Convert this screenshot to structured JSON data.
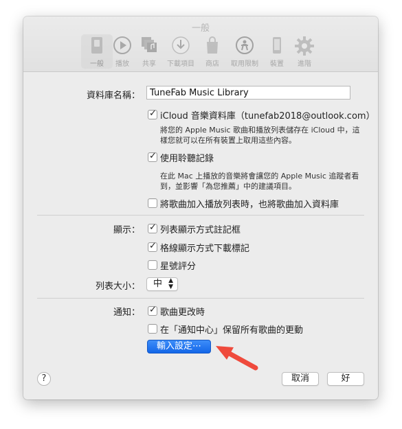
{
  "window": {
    "title": "一般"
  },
  "toolbar": {
    "items": [
      {
        "label": "一般",
        "icon": "general-switch-icon"
      },
      {
        "label": "播放",
        "icon": "play-icon"
      },
      {
        "label": "共享",
        "icon": "share-music-icon"
      },
      {
        "label": "下載項目",
        "icon": "download-icon"
      },
      {
        "label": "商店",
        "icon": "store-bag-icon"
      },
      {
        "label": "取用限制",
        "icon": "restrictions-icon"
      },
      {
        "label": "裝置",
        "icon": "device-icon"
      },
      {
        "label": "進階",
        "icon": "gear-icon"
      }
    ]
  },
  "library": {
    "name_label": "資料庫名稱：",
    "name_value": "TuneFab Music Library",
    "icloud_label": "iCloud 音樂資料庫（tunefab2018@outlook.com）",
    "icloud_checked": true,
    "icloud_desc_1": "將您的 Apple Music 歌曲和播放列表儲存在 iCloud 中，這",
    "icloud_desc_2": "樣您就可以在所有裝置上取用這些內容。",
    "history_label": "使用聆聽記錄",
    "history_checked": true,
    "history_desc_1": "在此 Mac 上播放的音樂將會讓您的 Apple Music 追蹤者看",
    "history_desc_2": "到，並影響「為您推薦」中的建議項目。",
    "add_songs_label": "將歌曲加入播放列表時，也將歌曲加入資料庫",
    "add_songs_checked": false
  },
  "display": {
    "label": "顯示：",
    "list_checkbox": "列表顯示方式註記框",
    "list_checked": true,
    "grid_download": "格線顯示方式下載標記",
    "grid_checked": true,
    "star_rating": "星號評分",
    "star_checked": false,
    "list_size_label": "列表大小：",
    "list_size_value": "中"
  },
  "notifications": {
    "label": "通知：",
    "song_change": "歌曲更改時",
    "song_change_checked": true,
    "keep_all": "在「通知中心」保留所有歌曲的更動",
    "keep_all_checked": false,
    "import_button": "輸入設定⋯"
  },
  "footer": {
    "help": "?",
    "cancel": "取消",
    "ok": "好"
  },
  "colors": {
    "accent": "#1a6ff0",
    "arrow": "#ef4a3c"
  }
}
